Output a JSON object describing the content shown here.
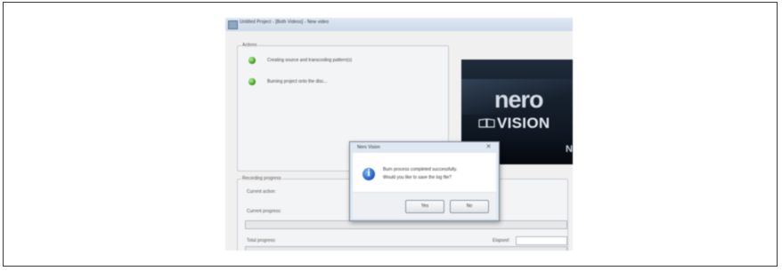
{
  "window": {
    "title": "Untitled Project - [Both Videos] - New video"
  },
  "actions": {
    "group_title": "Actions",
    "items": [
      {
        "label": "Creating source and transcoding pattern(s)"
      },
      {
        "label": "Burning project onto the disc..."
      }
    ]
  },
  "banner": {
    "logo_top": "nero",
    "logo_bottom": "VISION"
  },
  "recording": {
    "group_title": "Recording progress",
    "current_action_label": "Current action:",
    "current_progress_label": "Current progress:",
    "total_progress_label": "Total progress:",
    "elapsed_label": "Elapsed:",
    "current_progress": 0.0,
    "total_progress": 0.0
  },
  "dialog": {
    "title": "Nero Vision",
    "message_line1": "Burn process completed successfully.",
    "message_line2": "Would you like to save the log file?",
    "yes_label": "Yes",
    "no_label": "No"
  },
  "icons": {
    "status": "check-icon",
    "dialog": "info-icon"
  },
  "colors": {
    "status_ok": "#3ea31c",
    "info_blue": "#1d5fc2",
    "banner_bg": "#0f1722"
  }
}
